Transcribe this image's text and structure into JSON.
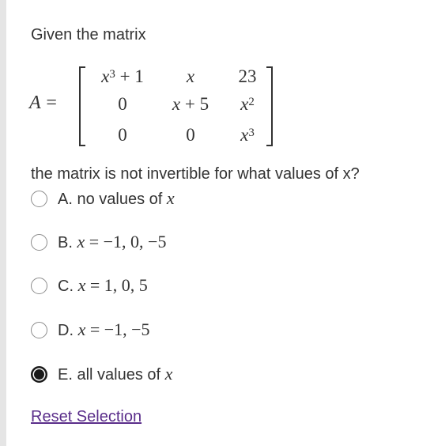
{
  "question": {
    "intro": "Given the matrix",
    "matrix_label": "A",
    "matrix_equals": "=",
    "matrix": {
      "rows": [
        [
          {
            "base": "x",
            "sup": "3",
            "tail": " + 1"
          },
          {
            "base": "x",
            "sup": "",
            "tail": ""
          },
          {
            "base": "23",
            "sup": "",
            "tail": ""
          }
        ],
        [
          {
            "base": "0",
            "sup": "",
            "tail": ""
          },
          {
            "base": "x",
            "sup": "",
            "tail": " + 5"
          },
          {
            "base": "x",
            "sup": "2",
            "tail": ""
          }
        ],
        [
          {
            "base": "0",
            "sup": "",
            "tail": ""
          },
          {
            "base": "0",
            "sup": "",
            "tail": ""
          },
          {
            "base": "x",
            "sup": "3",
            "tail": ""
          }
        ]
      ]
    },
    "prompt": "the matrix is not invertible for what values of x?"
  },
  "options": [
    {
      "letter": "A.",
      "text": "no values of",
      "math": "x",
      "math_tail": "",
      "checked": false
    },
    {
      "letter": "B.",
      "text": "",
      "math": "x",
      "math_tail": " = −1, 0, −5",
      "checked": false
    },
    {
      "letter": "C.",
      "text": "",
      "math": "x",
      "math_tail": " = 1, 0, 5",
      "checked": false
    },
    {
      "letter": "D.",
      "text": "",
      "math": "x",
      "math_tail": " = −1, −5",
      "checked": false
    },
    {
      "letter": "E.",
      "text": "all values of",
      "math": "x",
      "math_tail": "",
      "checked": true
    }
  ],
  "reset_label": "Reset Selection",
  "colors": {
    "text": "#333333",
    "link": "#5a2d8a",
    "radio_border": "#8c8c8c",
    "radio_checked": "#1a1a1a"
  }
}
